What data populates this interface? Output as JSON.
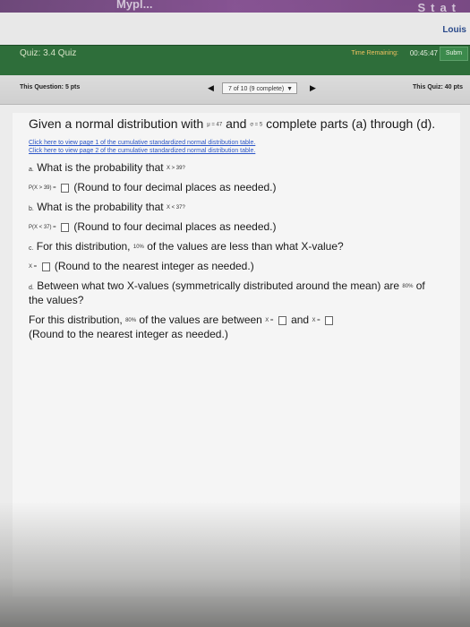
{
  "browser": {
    "top_text": "Mypl...",
    "tab_text": "Stat"
  },
  "header": {
    "user_name": "Louis",
    "quiz_title": "Quiz: 3.4 Quiz",
    "time_label": "Time Remaining:",
    "time_value": "00:45:47",
    "submit_label": "Subm"
  },
  "nav": {
    "question_score": "This Question: 5 pts",
    "question_select_value": "7 of 10 (9 complete)",
    "quiz_score": "This Quiz: 40 pts"
  },
  "question": {
    "text_part1": "Given a normal distribution with",
    "mu_symbol": "μ = 47",
    "text_part2": "and",
    "sigma_symbol": "σ = 5",
    "text_part3": "complete parts (a) through (d).",
    "link1": "Click here to view page 1 of the cumulative standardized normal distribution table.",
    "link2": "Click here to view page 2 of the cumulative standardized normal distribution table.",
    "part_a_marker": "a.",
    "part_a_text": "What is the probability that",
    "part_a_cond": "X > 39?",
    "part_a_prob": "P(X > 39) =",
    "part_a_instr": "(Round to four decimal places as needed.)",
    "part_b_marker": "b.",
    "part_b_text": "What is the probability that",
    "part_b_cond": "X < 37?",
    "part_b_prob": "P(X < 37) =",
    "part_b_instr": "(Round to four decimal places as needed.)",
    "part_c_marker": "c.",
    "part_c_text1": "For this distribution,",
    "part_c_pct": "10%",
    "part_c_text2": "of the values are less than what X-value?",
    "part_c_x": "X =",
    "part_c_instr": "(Round to the nearest integer as needed.)",
    "part_d_marker": "d.",
    "part_d_text1": "Between what two X-values (symmetrically distributed around the mean) are",
    "part_d_pct": "80%",
    "part_d_text2": "of",
    "part_d_text3": "the values?",
    "part_d_text4": "For this distribution,",
    "part_d_pct2": "80%",
    "part_d_text5": "of the values are between",
    "part_d_x1": "X =",
    "part_d_and": "and",
    "part_d_x2": "X =",
    "part_d_instr": "(Round to the nearest integer as needed.)"
  }
}
